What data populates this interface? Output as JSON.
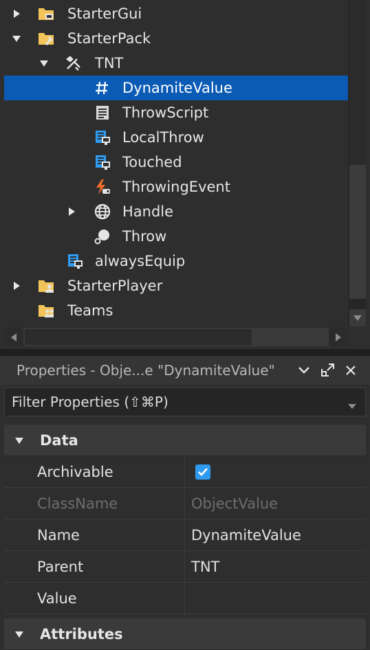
{
  "explorer": {
    "items": [
      {
        "label": "StarterGui",
        "icon": "folder-gui-icon",
        "expand": "collapsed"
      },
      {
        "label": "StarterPack",
        "icon": "folder-pack-icon",
        "expand": "expanded"
      },
      {
        "label": "TNT",
        "icon": "tool-icon",
        "expand": "expanded"
      },
      {
        "label": "DynamiteValue",
        "icon": "object-value-icon",
        "expand": "none",
        "selected": true
      },
      {
        "label": "ThrowScript",
        "icon": "script-icon",
        "expand": "none"
      },
      {
        "label": "LocalThrow",
        "icon": "local-script-icon",
        "expand": "none"
      },
      {
        "label": "Touched",
        "icon": "local-script-icon",
        "expand": "none"
      },
      {
        "label": "ThrowingEvent",
        "icon": "remote-event-icon",
        "expand": "none"
      },
      {
        "label": "Handle",
        "icon": "mesh-part-icon",
        "expand": "collapsed"
      },
      {
        "label": "Throw",
        "icon": "animation-icon",
        "expand": "none"
      },
      {
        "label": "alwaysEquip",
        "icon": "local-script-icon",
        "expand": "none"
      },
      {
        "label": "StarterPlayer",
        "icon": "folder-player-icon",
        "expand": "collapsed"
      },
      {
        "label": "Teams",
        "icon": "folder-teams-icon",
        "expand": "none"
      }
    ]
  },
  "properties": {
    "title": "Properties - Obje...e \"DynamiteValue\"",
    "filter_placeholder": "Filter Properties (⇧⌘P)",
    "categories": [
      {
        "label": "Data"
      },
      {
        "label": "Attributes"
      }
    ],
    "rows": [
      {
        "name": "Archivable",
        "value": "",
        "checked": true
      },
      {
        "name": "ClassName",
        "value": "ObjectValue",
        "readonly": true
      },
      {
        "name": "Name",
        "value": "DynamiteValue"
      },
      {
        "name": "Parent",
        "value": "TNT"
      },
      {
        "name": "Value",
        "value": ""
      }
    ]
  },
  "colors": {
    "selection": "#0b5bb5",
    "folder": "#f2c45a",
    "script_blue": "#2f9bf0",
    "event_orange": "#f26b2a",
    "checkbox": "#2f9bf0"
  }
}
